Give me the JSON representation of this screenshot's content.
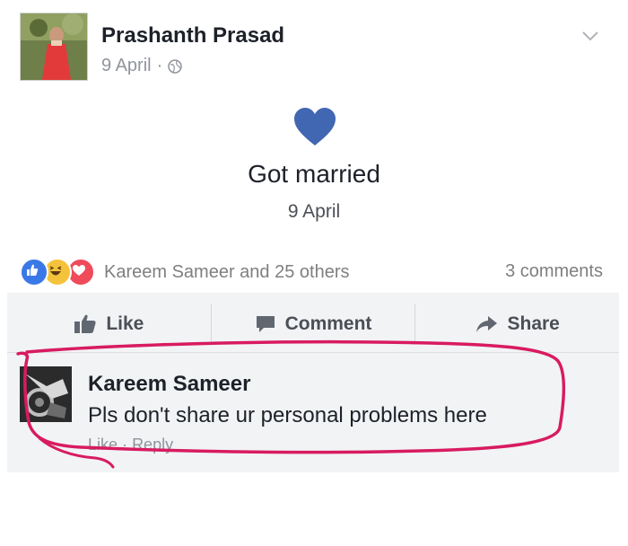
{
  "post": {
    "author": "Prashanth Prasad",
    "date": "9 April",
    "separator": "·"
  },
  "event": {
    "title": "Got married",
    "date": "9 April"
  },
  "reactions": {
    "names": "Kareem Sameer and 25 others",
    "comments": "3 comments"
  },
  "actions": {
    "like": "Like",
    "comment": "Comment",
    "share": "Share"
  },
  "comment": {
    "author": "Kareem Sameer",
    "text": "Pls don't share ur personal problems here",
    "like": "Like",
    "dot": "·",
    "reply": "Reply"
  },
  "colors": {
    "heart": "#4267b2",
    "annotation": "#d81b60"
  }
}
